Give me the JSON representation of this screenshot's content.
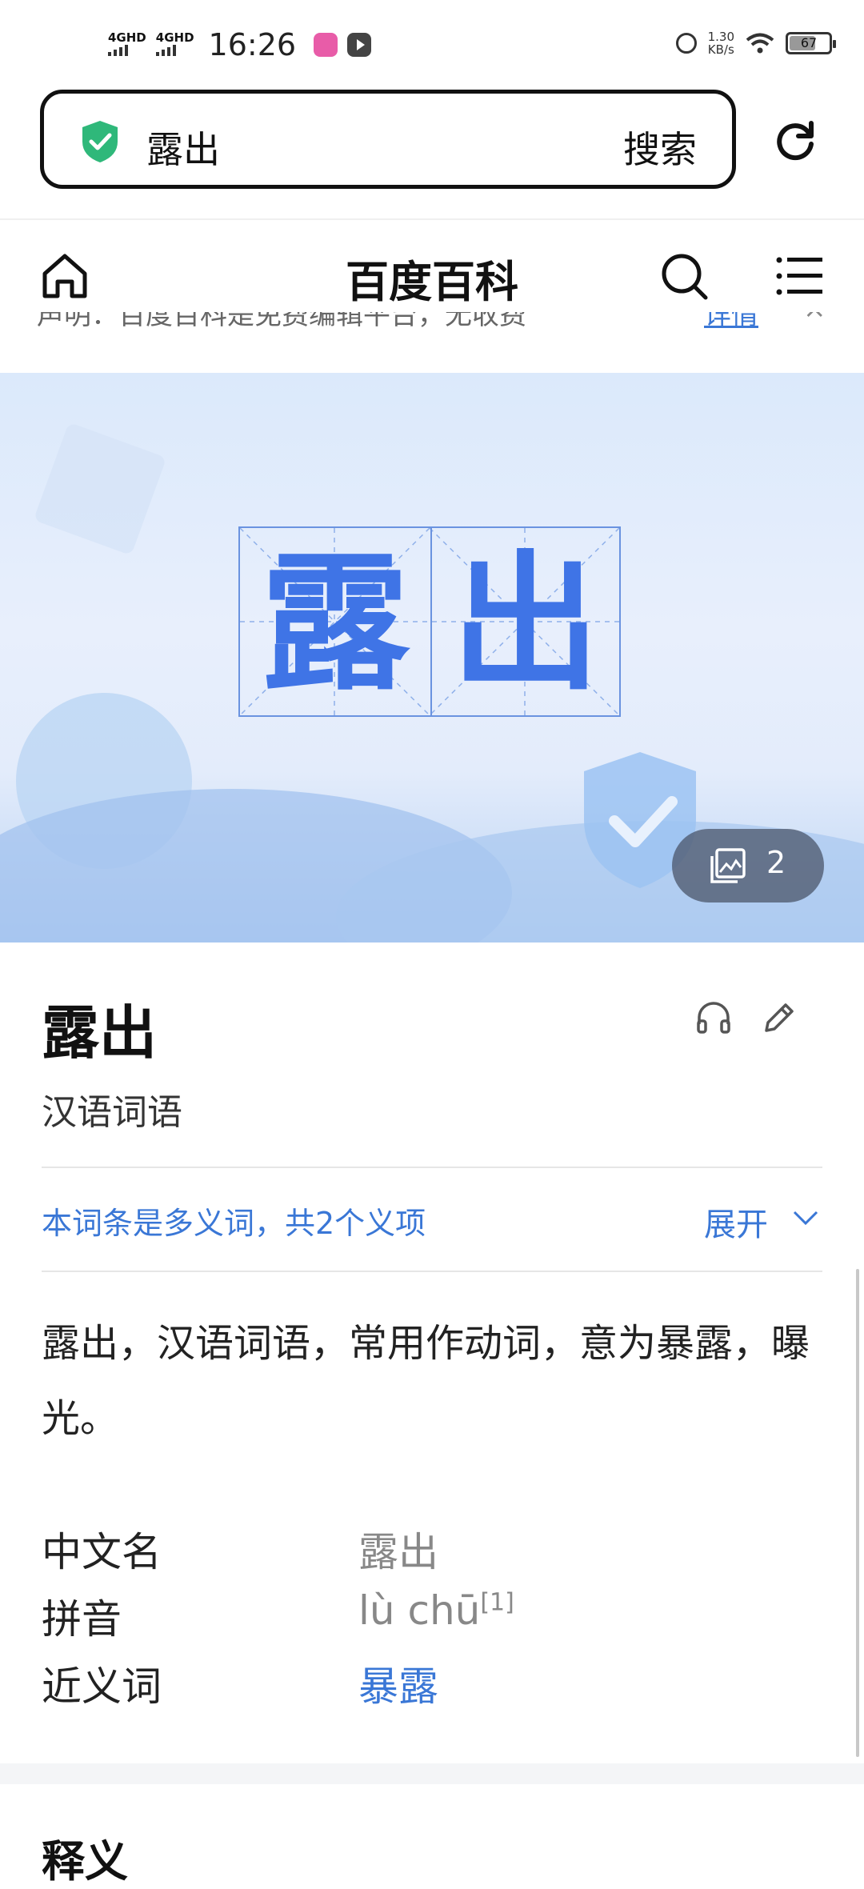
{
  "status_bar": {
    "sim1": "4GHD",
    "sim2": "4GHD",
    "time": "16:26",
    "speed_value": "1.30",
    "speed_unit": "KB/s",
    "battery": "67"
  },
  "search": {
    "query": "露出",
    "button": "搜索"
  },
  "nav": {
    "brand": "百度百科"
  },
  "notice": {
    "text": "声明：百度百科是免费编辑平台，无收费",
    "link": "详情",
    "close": "×"
  },
  "banner": {
    "char1": "露",
    "char2": "出",
    "photo_count": "2"
  },
  "entry": {
    "title": "露出",
    "subtitle": "汉语词语",
    "polysemy": "本词条是多义词，共2个义项",
    "expand": "展开",
    "description": "露出，汉语词语，常用作动词，意为暴露，曝光。"
  },
  "infobox": [
    {
      "key": "中文名",
      "value": "露出",
      "link": false,
      "ref": ""
    },
    {
      "key": "拼音",
      "value": "lù chū",
      "link": false,
      "ref": "[1]"
    },
    {
      "key": "近义词",
      "value": "暴露",
      "link": true,
      "ref": ""
    }
  ],
  "section": {
    "title": "释义"
  },
  "colors": {
    "accent": "#3a77d6",
    "shield": "#2fb87a",
    "banner_char": "#3f74e6"
  }
}
